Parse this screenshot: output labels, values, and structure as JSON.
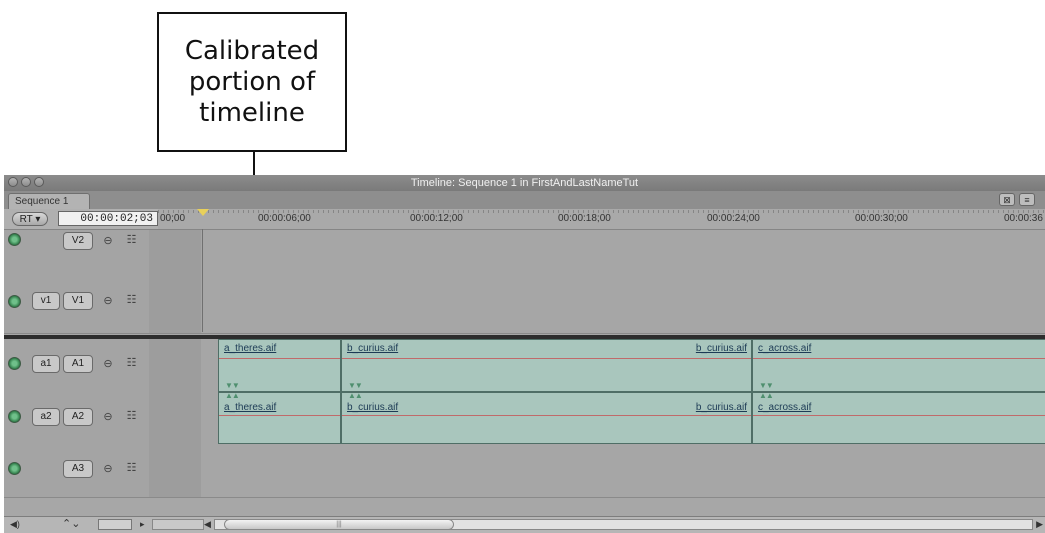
{
  "callout": {
    "lines": [
      "Calibrated",
      "portion of",
      "timeline"
    ]
  },
  "window": {
    "title": "Timeline: Sequence 1 in FirstAndLastNameTut",
    "tab": "Sequence 1"
  },
  "header": {
    "rt_label": "RT",
    "timecode": "00:00:02;03",
    "ruler_labels": [
      "00;00",
      "00:00:06;00",
      "00:00:12;00",
      "00:00:18;00",
      "00:00:24;00",
      "00:00:30;00",
      "00:00:36"
    ]
  },
  "tracks": {
    "v2": {
      "dest": "",
      "label": "V2"
    },
    "v1": {
      "dest": "v1",
      "label": "V1"
    },
    "a1": {
      "dest": "a1",
      "label": "A1"
    },
    "a2": {
      "dest": "a2",
      "label": "A2"
    },
    "a3": {
      "dest": "",
      "label": "A3"
    }
  },
  "clips": {
    "a1": [
      "a_theres.aif",
      "b_curius.aif",
      "b_curius.aif",
      "c_across.aif"
    ],
    "a2": [
      "a_theres.aif",
      "b_curius.aif",
      "b_curius.aif",
      "c_across.aif"
    ]
  },
  "colors": {
    "clip_fill": "#a9c6bd",
    "clip_name": "#1d3b55",
    "playhead": "#e8d05a"
  },
  "icons": [
    "lock-icon",
    "visibility-icon",
    "track-eye-icon",
    "speaker-icon",
    "clip-overlay-icon",
    "scroll-left-icon",
    "scroll-right-icon"
  ]
}
